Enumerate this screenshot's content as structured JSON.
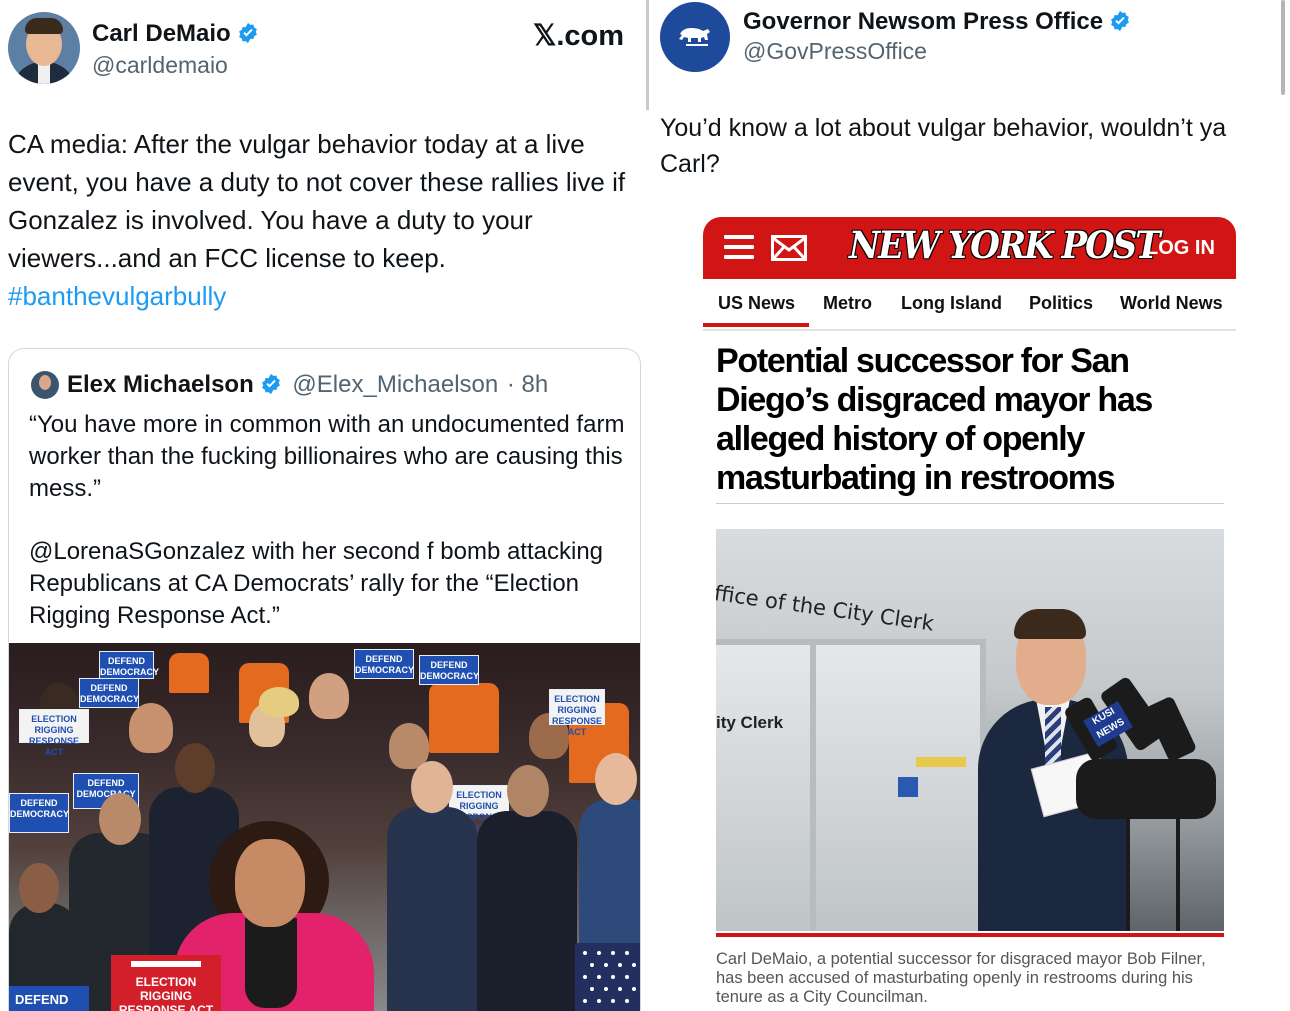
{
  "left_tweet": {
    "author_name": "Carl DeMaio",
    "author_handle": "@carldemaio",
    "watermark": "𝕏.com",
    "text": "CA media: After the vulgar behavior today at a live event, you have a duty to not cover these rallies live if Gonzalez is involved.  You have a duty to your viewers...and an FCC license to keep.",
    "hashtag": "#banthevulgarbully",
    "quoted": {
      "author_name": "Elex Michaelson",
      "author_handle": "@Elex_Michaelson",
      "time": "· 8h",
      "paragraph1": "“You have more in common with an undocumented farm worker than the fucking billionaires who are causing this mess.”",
      "paragraph2": "@LorenaSGonzalez with her second f bomb attacking Republicans at CA Democrats’ rally for the “Election Rigging Response Act.”",
      "photo": {
        "sign_defend": "DEFEND DEMOCRACY",
        "sign_corner": "DEFEND",
        "podium_sign": "ELECTION RIGGING RESPONSE ACT",
        "small_sign": "ELECTION RIGGING RESPONSE ACT"
      }
    }
  },
  "right_tweet": {
    "author_name": "Governor Newsom Press Office",
    "author_handle": "@GovPressOffice",
    "text": "You’d know a lot about vulgar behavior, wouldn’t ya Carl?",
    "nypost": {
      "logo": "NEW YORK POST",
      "login": "LOG IN",
      "nav": [
        "US News",
        "Metro",
        "Long Island",
        "Politics",
        "World News"
      ],
      "headline": "Potential successor for San Diego’s disgraced mayor has alleged history of openly masturbating in restrooms",
      "photo_sign_top": "ffice of the City Clerk",
      "photo_sign_office": "ity Clerk",
      "photo_mic_label": "KUSI NEWS",
      "caption": "Carl DeMaio, a potential successor for disgraced mayor Bob Filner, has been accused of masturbating openly in restrooms during his tenure as a City Councilman."
    }
  },
  "colors": {
    "verified": "#1d9bf0",
    "link": "#1d9bf0",
    "nypost_red": "#d11414",
    "gov_avatar": "#1d4a9b"
  },
  "icons": [
    "verified-badge-icon",
    "menu-icon",
    "mail-icon",
    "bear-flag-icon"
  ]
}
